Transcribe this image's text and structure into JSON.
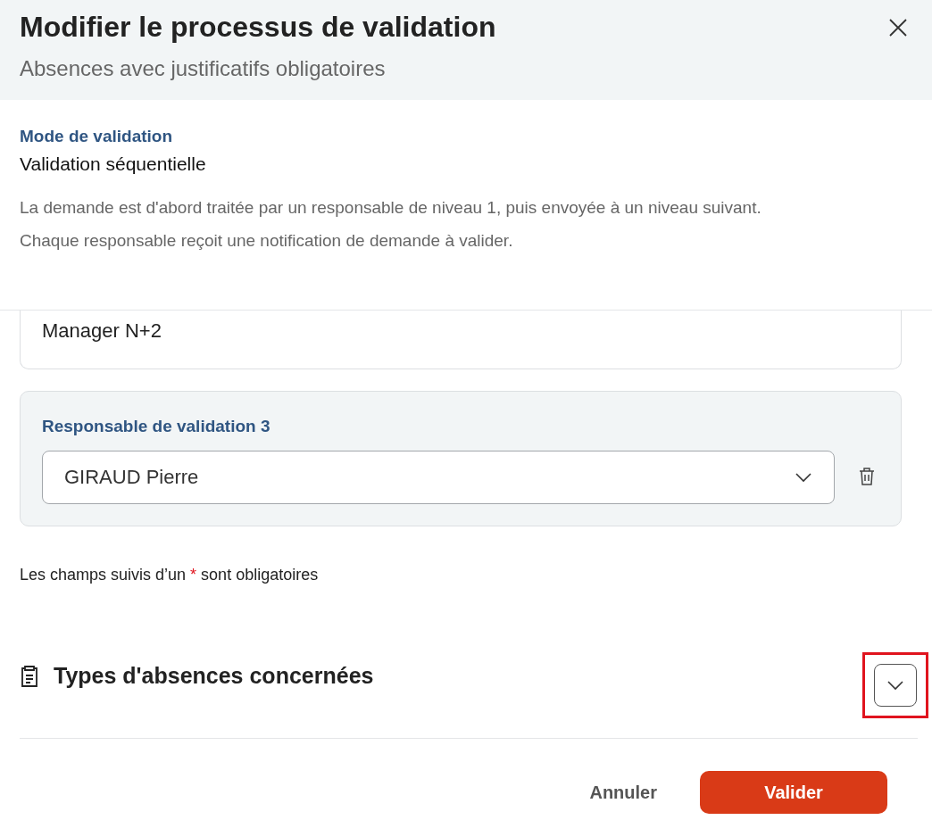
{
  "dialog": {
    "title": "Modifier le processus de validation",
    "subtitle": "Absences avec justificatifs obligatoires"
  },
  "mode": {
    "label": "Mode de validation",
    "value": "Validation séquentielle",
    "description": [
      "La demande est d'abord traitée par un responsable de niveau 1, puis envoyée à un niveau suivant.",
      "Chaque responsable reçoit une notification de demande à valider."
    ]
  },
  "approvers": [
    {
      "kind": "partial",
      "value": "Manager N+2"
    },
    {
      "kind": "select",
      "label": "Responsable de validation 3",
      "value": "GIRAUD Pierre"
    }
  ],
  "required_note": {
    "before": "Les champs suivis d’un ",
    "mark": "*",
    "after": " sont obligatoires"
  },
  "section": {
    "title": "Types d'absences concernées",
    "expanded": false,
    "highlighted": true
  },
  "buttons": [
    {
      "kind": "secondary",
      "label": "Annuler"
    },
    {
      "kind": "primary",
      "label": "Valider"
    }
  ]
}
